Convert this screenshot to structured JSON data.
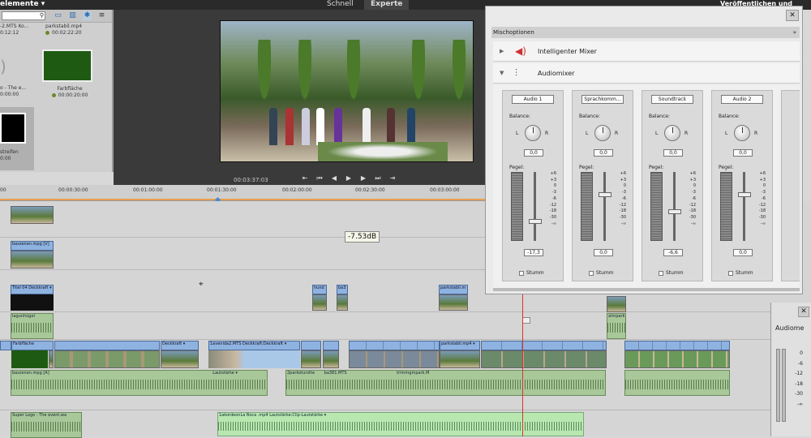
{
  "topbar": {
    "elements_label": "elemente ▾",
    "mode_quick": "Schnell",
    "mode_expert": "Experte",
    "publish_label": "Veröffentlichen und Freigebe"
  },
  "media": {
    "items": [
      {
        "name": "-2.MTS Ko...",
        "time": "0:12:12"
      },
      {
        "name": "parkstabil.mp4",
        "time": "00:02:22:20"
      },
      {
        "name": "o - The e...",
        "time": "0:00:00"
      },
      {
        "name": "Farbfläche",
        "time": "00:00:20:00"
      },
      {
        "name": "streifen",
        "time": "0:00"
      }
    ]
  },
  "monitor": {
    "timecode": "00:03:37:03",
    "controls": [
      "⇤",
      "⏮",
      "◀",
      "▶",
      "▶",
      "⏭",
      "⇥"
    ]
  },
  "ruler": {
    "labels": [
      "00",
      "00:00:30:00",
      "00:01:00:00",
      "00:01:30:00",
      "00:02:00:00",
      "00:02:30:00",
      "00:03:00:00"
    ]
  },
  "timeline": {
    "tooltip": "-7.53dB",
    "clips": {
      "baszenen": "baszenen.mpg [V]",
      "titel": "Titel 04 Deckkraft ▾",
      "hund": "hund",
      "ba3": "ba3",
      "parkstabil": "parkstabil.m",
      "lagundhigel": "lagunhügel",
      "almpark": "almpark",
      "farbflaeche": "Farbfläche",
      "deckkraft": "Deckkraft ▾",
      "laverida": "1avenida2.MTS Deckkraft:Deckkraft ▾",
      "parkstabil_v": "parkstabil.mp4 ▾",
      "baszenen_a": "baszenen.mpg [A]",
      "lautstaerke": "Lautstärke ▾",
      "parkoturstte": "2parkoturstte",
      "ba381": "ba381.MTS",
      "trimmgmpark": "trimmgmpark.M",
      "superlogo": "Super Logo - The event.wa",
      "akordeon": "1akordeonLa Boca .mp4 Lautstärke:Clip-Lautstärke ▾"
    }
  },
  "mixer": {
    "header": "Mischoptionen",
    "close": "✕",
    "rows": [
      "Intelligenter Mixer",
      "Audiomixer"
    ],
    "balance_label": "Balance:",
    "pegel_label": "Pegel:",
    "L": "L",
    "R": "R",
    "mute_label": "Stumm",
    "scale": [
      "+6",
      "+3",
      "0",
      "-3",
      "-6",
      "-12",
      "-18",
      "-30",
      "-∞"
    ],
    "channels": [
      {
        "name": "Audio 1",
        "balance": "0,0",
        "level": "-17,3",
        "fader_pct": 0.72
      },
      {
        "name": "Sprachkomm...",
        "balance": "0,0",
        "level": "0,0",
        "fader_pct": 0.33
      },
      {
        "name": "Soundtrack",
        "balance": "0,0",
        "level": "-6,6",
        "fader_pct": 0.58
      },
      {
        "name": "Audio 2",
        "balance": "0,0",
        "level": "0,0",
        "fader_pct": 0.33
      }
    ]
  },
  "audiometer": {
    "title": "Audiome",
    "close": "✕",
    "scale": [
      "0",
      "-6",
      "-12",
      "-18",
      "-30",
      "-∞"
    ]
  }
}
